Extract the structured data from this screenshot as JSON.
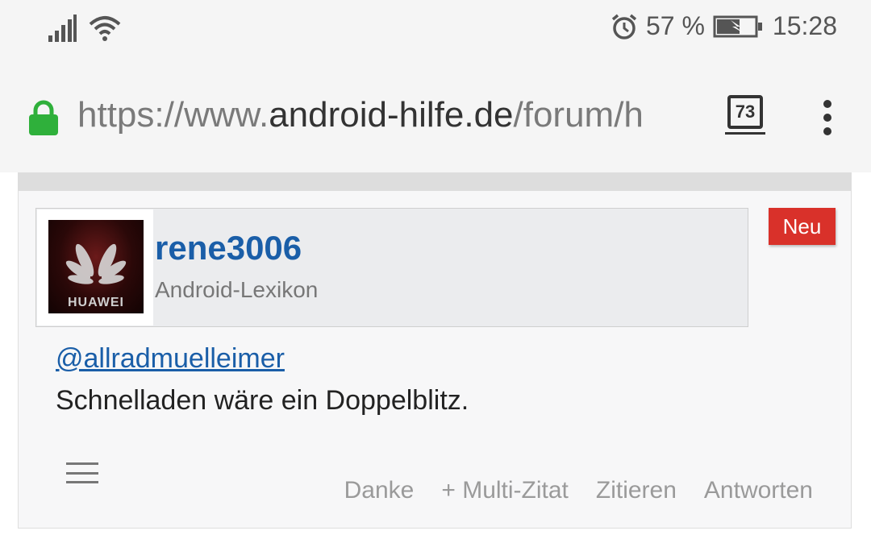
{
  "status_bar": {
    "battery_percent": "57 %",
    "time": "15:28",
    "icons": [
      "signal-icon",
      "wifi-icon",
      "alarm-icon",
      "battery-charging-icon"
    ]
  },
  "browser": {
    "url_scheme": "https://www.",
    "url_host": "android-hilfe.de",
    "url_path": "/forum/h",
    "tab_count": "73",
    "lock_color": "#2fb03b"
  },
  "post": {
    "badge": "Neu",
    "badge_color": "#d9312a",
    "avatar_text": "HUAWEI",
    "username": "rene3006",
    "user_title": "Android-Lexikon",
    "mention": "@allradmuelleimer",
    "text": "Schnelladen wäre ein Doppelblitz.",
    "actions": {
      "thanks": "Danke",
      "multi_quote": "+ Multi-Zitat",
      "quote": "Zitieren",
      "reply": "Antworten"
    }
  }
}
